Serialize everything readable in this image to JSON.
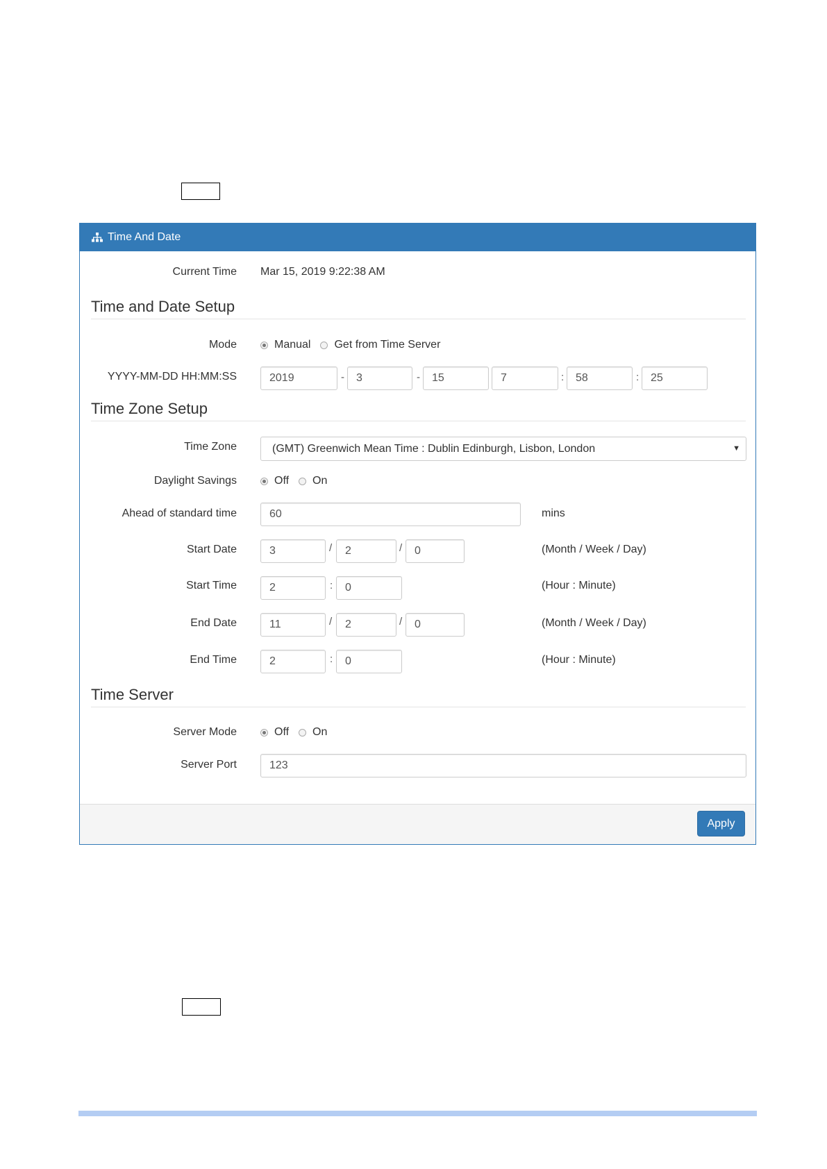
{
  "panel": {
    "title": "Time And Date",
    "title_icon": "sitemap-icon"
  },
  "current_time": {
    "label": "Current Time",
    "value": "Mar 15, 2019 9:22:38 AM"
  },
  "time_date_setup": {
    "heading": "Time and Date Setup",
    "mode": {
      "label": "Mode",
      "options": [
        "Manual",
        "Get from Time Server"
      ],
      "selected": "Manual"
    },
    "datetime": {
      "label": "YYYY-MM-DD HH:MM:SS",
      "year": "2019",
      "month": "3",
      "day": "15",
      "hour": "7",
      "minute": "58",
      "second": "25",
      "dash": "-",
      "colon": ":"
    }
  },
  "time_zone_setup": {
    "heading": "Time Zone Setup",
    "time_zone": {
      "label": "Time Zone",
      "selected": "(GMT) Greenwich Mean Time : Dublin Edinburgh, Lisbon, London",
      "caret": "▼"
    },
    "daylight_savings": {
      "label": "Daylight Savings",
      "options": [
        "Off",
        "On"
      ],
      "selected": "Off"
    },
    "ahead": {
      "label": "Ahead of standard time",
      "value": "60",
      "unit": "mins"
    },
    "start_date": {
      "label": "Start Date",
      "month": "3",
      "week": "2",
      "day": "0",
      "hint": "(Month / Week / Day)"
    },
    "start_time": {
      "label": "Start Time",
      "hour": "2",
      "minute": "0",
      "hint": "(Hour : Minute)"
    },
    "end_date": {
      "label": "End Date",
      "month": "11",
      "week": "2",
      "day": "0",
      "hint": "(Month / Week / Day)"
    },
    "end_time": {
      "label": "End Time",
      "hour": "2",
      "minute": "0",
      "hint": "(Hour : Minute)"
    },
    "slash": "/",
    "colon": ":"
  },
  "time_server": {
    "heading": "Time Server",
    "server_mode": {
      "label": "Server Mode",
      "options": [
        "Off",
        "On"
      ],
      "selected": "Off"
    },
    "server_port": {
      "label": "Server Port",
      "value": "123"
    }
  },
  "footer": {
    "apply_label": "Apply"
  },
  "colors": {
    "primary": "#337ab7",
    "footer_bg": "#f5f5f5",
    "page_rule": "#b4cdf3"
  }
}
